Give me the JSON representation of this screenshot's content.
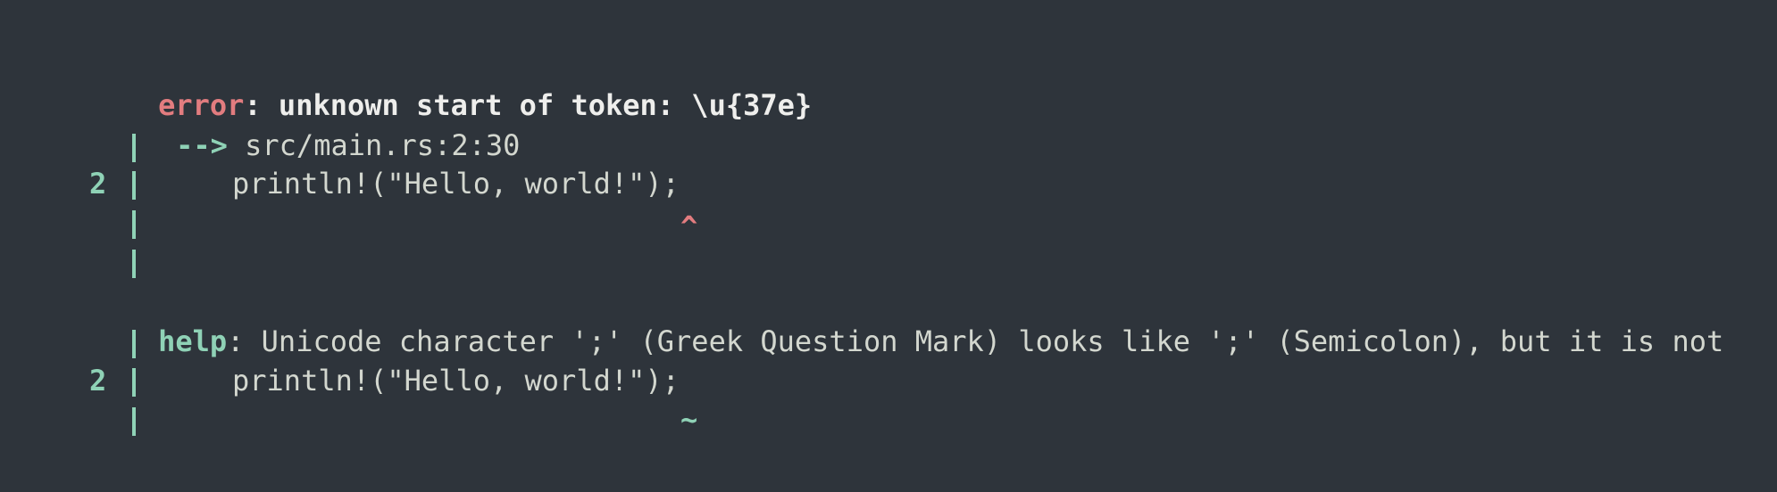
{
  "diagnostic": {
    "error_label": "error",
    "error_sep": ":",
    "error_message": " unknown start of token: \\u{37e}",
    "location_arrow": "-->",
    "location_path": "src/main.rs:2:30",
    "snippet1": {
      "line_number": "2",
      "code": "println!(\"Hello, world!\");",
      "marker": "^"
    },
    "help_label": "help",
    "help_sep": ":",
    "help_message": " Unicode character ';' (Greek Question Mark) looks like ';' (Semicolon), but it is not",
    "snippet2": {
      "line_number": "2",
      "code": "println!(\"Hello, world!\");",
      "marker": "~"
    }
  },
  "colors": {
    "background": "#2e343b",
    "error": "#e27c7f",
    "gutter": "#8fd2b6",
    "text": "#d3d7cf"
  }
}
